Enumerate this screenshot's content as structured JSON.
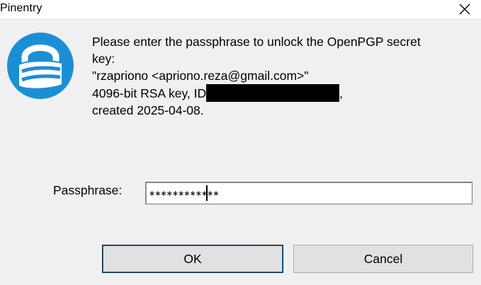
{
  "window": {
    "title": "Pinentry",
    "close_icon": "close-icon"
  },
  "logo": {
    "icon": "gnupg-lock-icon",
    "color": "#1b8fd6"
  },
  "message": {
    "line1": "Please enter the passphrase to unlock the OpenPGP secret",
    "line2": "key:",
    "line3": "\"rzapriono <apriono.reza@gmail.com>\"",
    "line4_prefix": "4096-bit RSA key, ID",
    "line4_suffix": ",",
    "line5": "created 2025-04-08."
  },
  "passphrase": {
    "label": "Passphrase:",
    "masked_value": "∗∗∗∗∗∗∗∗∗∗∗∗"
  },
  "buttons": {
    "ok_label": "OK",
    "cancel_label": "Cancel"
  }
}
